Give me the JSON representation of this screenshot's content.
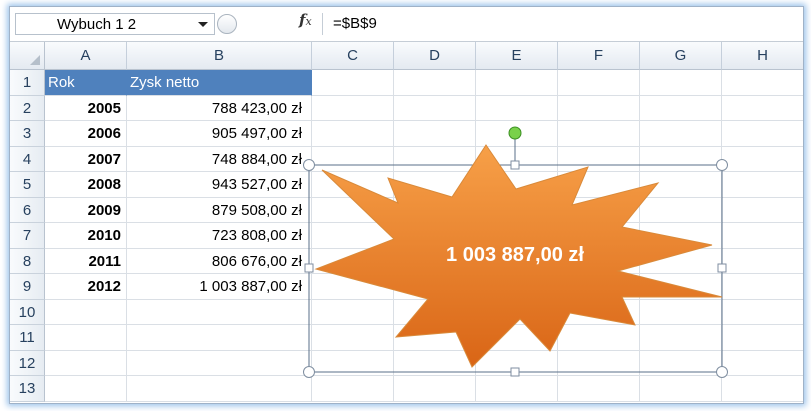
{
  "formula_bar": {
    "name_box": "Wybuch 1 2",
    "fx_label": "f",
    "fx_sub": "x",
    "formula": "=$B$9"
  },
  "columns": [
    "A",
    "B",
    "C",
    "D",
    "E",
    "F",
    "G",
    "H"
  ],
  "rows": [
    "1",
    "2",
    "3",
    "4",
    "5",
    "6",
    "7",
    "8",
    "9",
    "10",
    "11",
    "12",
    "13"
  ],
  "table": {
    "header": {
      "a": "Rok",
      "b": "Zysk netto"
    },
    "data": [
      {
        "year": "2005",
        "value": "788 423,00 zł"
      },
      {
        "year": "2006",
        "value": "905 497,00 zł"
      },
      {
        "year": "2007",
        "value": "748 884,00 zł"
      },
      {
        "year": "2008",
        "value": "943 527,00 zł"
      },
      {
        "year": "2009",
        "value": "879 508,00 zł"
      },
      {
        "year": "2010",
        "value": "723 808,00 zł"
      },
      {
        "year": "2011",
        "value": "806 676,00 zł"
      },
      {
        "year": "2012",
        "value": "1 003 887,00 zł"
      }
    ]
  },
  "shape": {
    "text": "1 003 887,00 zł",
    "fill_top": "#f7a048",
    "fill_bottom": "#d96516"
  },
  "colors": {
    "header_fill": "#4f81bd"
  }
}
